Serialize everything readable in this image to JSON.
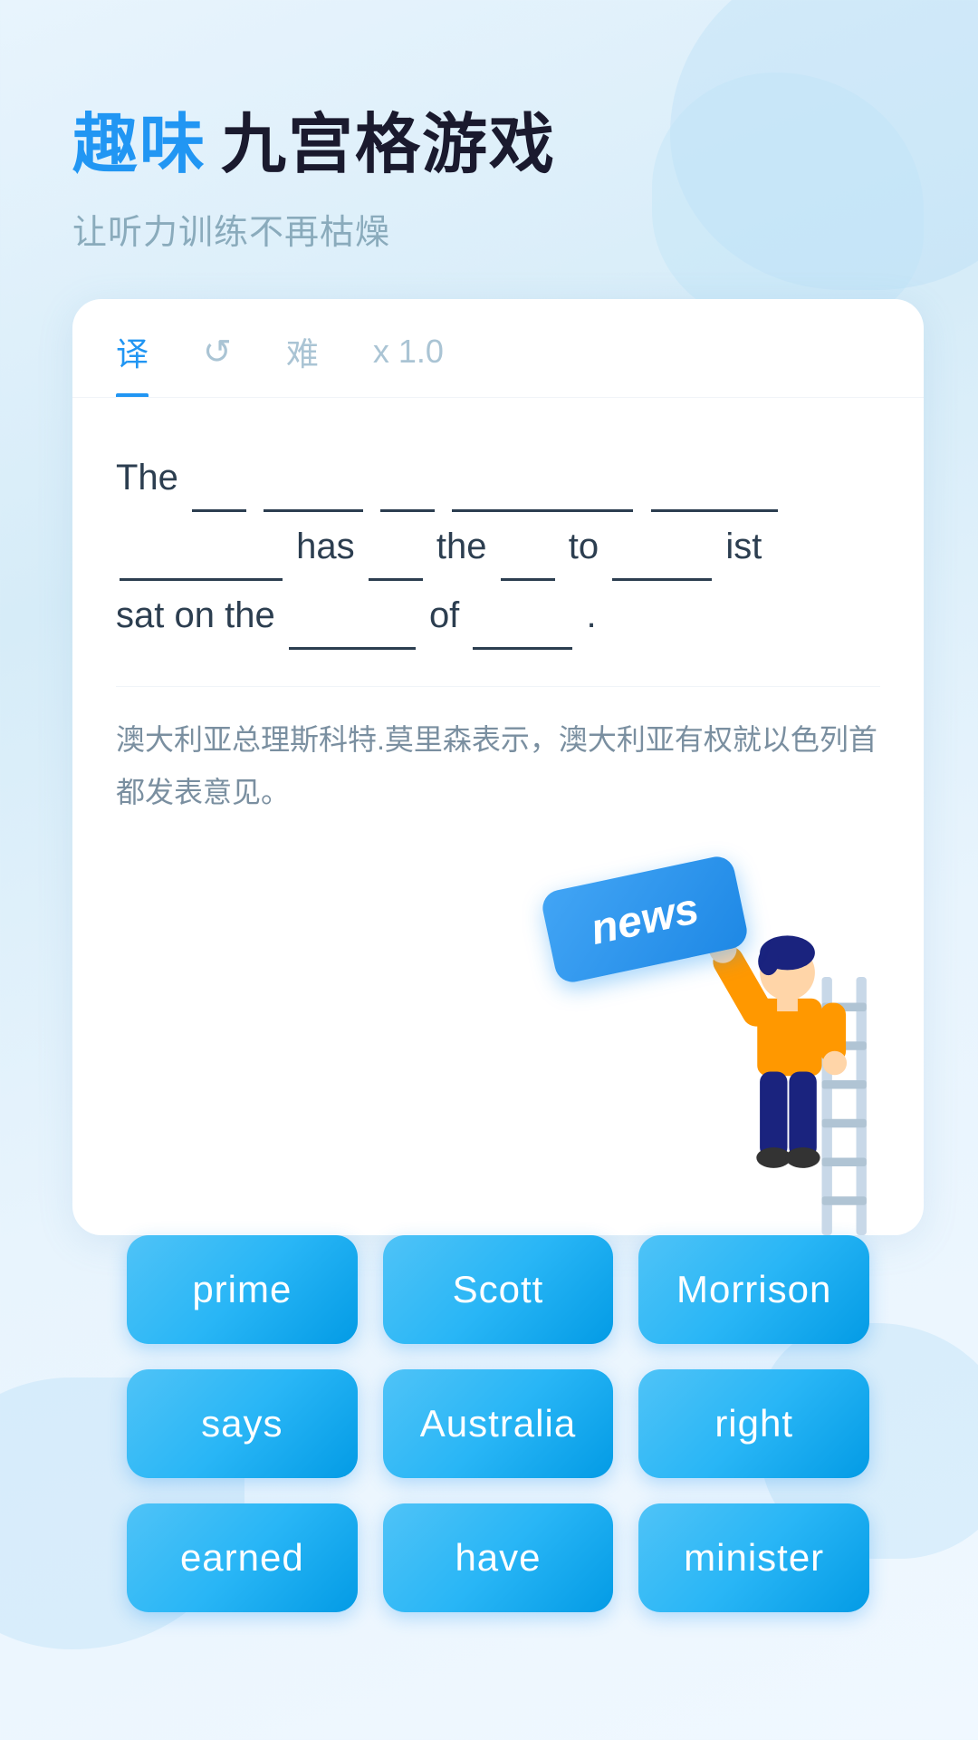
{
  "header": {
    "title_blue": "趣味",
    "title_dark": "九宫格游戏",
    "subtitle": "让听力训练不再枯燥"
  },
  "tabs": [
    {
      "label": "译",
      "active": true
    },
    {
      "label": "↺",
      "active": false
    },
    {
      "label": "难",
      "active": false
    },
    {
      "label": "x 1.0",
      "active": false
    }
  ],
  "sentence": {
    "text_display": "The ___ ______ ___ __________ _____ ________has ___ the ___ to _____ist sat on the ____ of ____.",
    "translation": "澳大利亚总理斯科特.莫里森表示，澳大利亚有权就以色列首都发表意见。"
  },
  "news_badge": "news",
  "word_buttons": [
    {
      "label": "prime",
      "id": "prime"
    },
    {
      "label": "Scott",
      "id": "scott"
    },
    {
      "label": "Morrison",
      "id": "morrison"
    },
    {
      "label": "says",
      "id": "says"
    },
    {
      "label": "Australia",
      "id": "australia"
    },
    {
      "label": "right",
      "id": "right"
    },
    {
      "label": "earned",
      "id": "earned"
    },
    {
      "label": "have",
      "id": "have"
    },
    {
      "label": "minister",
      "id": "minister"
    }
  ]
}
